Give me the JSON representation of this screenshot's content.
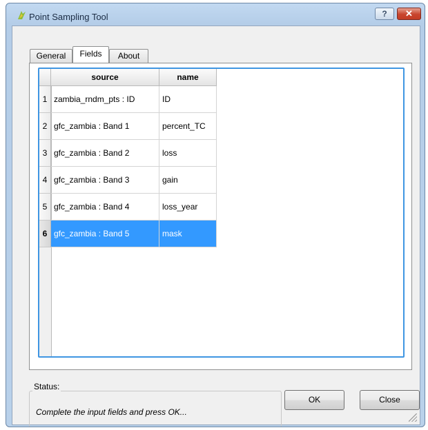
{
  "window": {
    "title": "Point Sampling Tool",
    "help_label": "?",
    "close_label": "✕"
  },
  "tabs": [
    {
      "label": "General"
    },
    {
      "label": "Fields"
    },
    {
      "label": "About"
    }
  ],
  "table": {
    "columns": [
      "source",
      "name"
    ],
    "rows": [
      {
        "num": "1",
        "source": "zambia_rndm_pts : ID",
        "name": "ID"
      },
      {
        "num": "2",
        "source": "gfc_zambia : Band 1",
        "name": "percent_TC"
      },
      {
        "num": "3",
        "source": "gfc_zambia : Band 2",
        "name": "loss"
      },
      {
        "num": "4",
        "source": "gfc_zambia : Band 3",
        "name": "gain"
      },
      {
        "num": "5",
        "source": "gfc_zambia : Band 4",
        "name": "loss_year"
      },
      {
        "num": "6",
        "source": "gfc_zambia : Band 5",
        "name": "mask"
      }
    ],
    "selected_row": 6
  },
  "status": {
    "label": "Status:",
    "message": "Complete the input fields and press OK..."
  },
  "buttons": {
    "ok": "OK",
    "close": "Close"
  },
  "colors": {
    "selection": "#3399ff",
    "focus_border": "#3e95e2"
  }
}
